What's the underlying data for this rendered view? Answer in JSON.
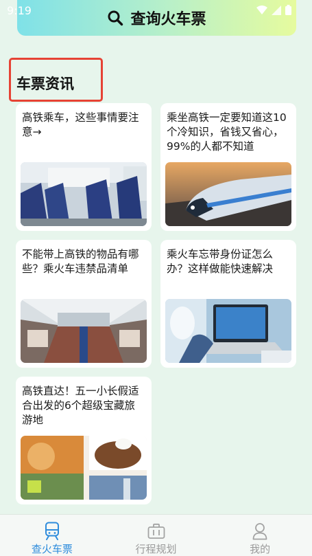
{
  "status_bar": {
    "time": "9:19"
  },
  "header": {
    "title": "查询火车票",
    "icon": "search-icon"
  },
  "section": {
    "title": "车票资讯"
  },
  "articles": [
    {
      "title": "高铁乘车，这些事情要注意→",
      "image": "train-seats-photo"
    },
    {
      "title": "乘坐高铁一定要知道这10个冷知识，省钱又省心，99%的人都不知道",
      "image": "bullet-train-photo"
    },
    {
      "title": "不能带上高铁的物品有哪些？乘火车违禁品清单",
      "image": "train-interior-photo"
    },
    {
      "title": "乘火车忘带身份证怎么办？这样做能快速解决",
      "image": "laptop-traveler-photo"
    },
    {
      "title": "高铁直达！五一小长假适合出发的6个超级宝藏旅游地",
      "image": "travel-collage-photo"
    }
  ],
  "bottom_nav": [
    {
      "label": "查火车票",
      "icon": "train-icon",
      "active": true
    },
    {
      "label": "行程规划",
      "icon": "briefcase-icon",
      "active": false
    },
    {
      "label": "我的",
      "icon": "user-icon",
      "active": false
    }
  ],
  "colors": {
    "accent": "#2e8cdc",
    "highlight_border": "#e64234",
    "background": "#e7f5ec"
  }
}
